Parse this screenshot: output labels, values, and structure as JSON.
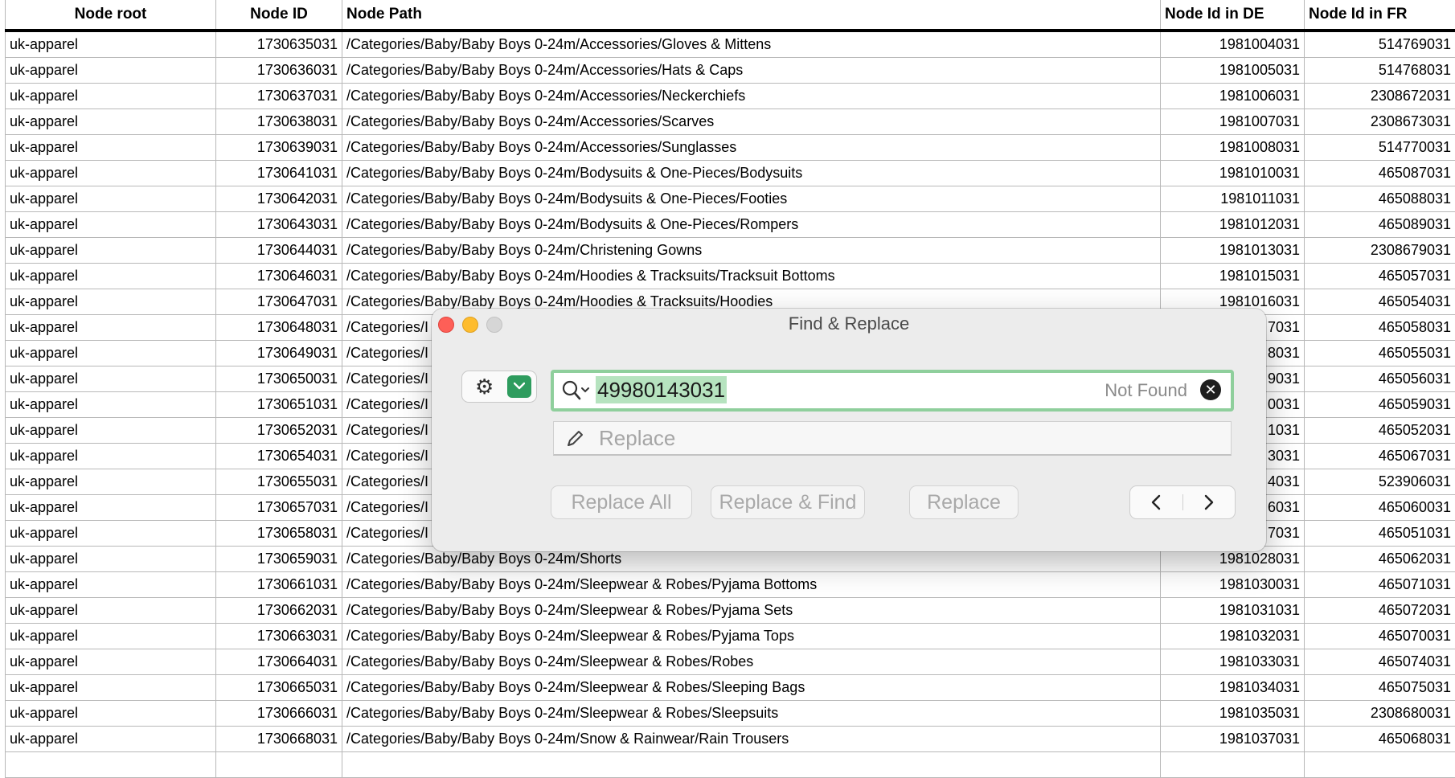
{
  "sheet": {
    "columns": [
      "Node root",
      "Node ID",
      "Node Path",
      "Node Id in DE",
      "Node Id in FR"
    ],
    "rows": [
      [
        "uk-apparel",
        "1730635031",
        "/Categories/Baby/Baby Boys 0-24m/Accessories/Gloves & Mittens",
        "1981004031",
        "514769031"
      ],
      [
        "uk-apparel",
        "1730636031",
        "/Categories/Baby/Baby Boys 0-24m/Accessories/Hats & Caps",
        "1981005031",
        "514768031"
      ],
      [
        "uk-apparel",
        "1730637031",
        "/Categories/Baby/Baby Boys 0-24m/Accessories/Neckerchiefs",
        "1981006031",
        "2308672031"
      ],
      [
        "uk-apparel",
        "1730638031",
        "/Categories/Baby/Baby Boys 0-24m/Accessories/Scarves",
        "1981007031",
        "2308673031"
      ],
      [
        "uk-apparel",
        "1730639031",
        "/Categories/Baby/Baby Boys 0-24m/Accessories/Sunglasses",
        "1981008031",
        "514770031"
      ],
      [
        "uk-apparel",
        "1730641031",
        "/Categories/Baby/Baby Boys 0-24m/Bodysuits & One-Pieces/Bodysuits",
        "1981010031",
        "465087031"
      ],
      [
        "uk-apparel",
        "1730642031",
        "/Categories/Baby/Baby Boys 0-24m/Bodysuits & One-Pieces/Footies",
        "1981011031",
        "465088031"
      ],
      [
        "uk-apparel",
        "1730643031",
        "/Categories/Baby/Baby Boys 0-24m/Bodysuits & One-Pieces/Rompers",
        "1981012031",
        "465089031"
      ],
      [
        "uk-apparel",
        "1730644031",
        "/Categories/Baby/Baby Boys 0-24m/Christening Gowns",
        "1981013031",
        "2308679031"
      ],
      [
        "uk-apparel",
        "1730646031",
        "/Categories/Baby/Baby Boys 0-24m/Hoodies & Tracksuits/Tracksuit Bottoms",
        "1981015031",
        "465057031"
      ],
      [
        "uk-apparel",
        "1730647031",
        "/Categories/Baby/Baby Boys 0-24m/Hoodies & Tracksuits/Hoodies",
        "1981016031",
        "465054031"
      ],
      [
        "uk-apparel",
        "1730648031",
        "/Categories/I",
        "7031",
        "465058031"
      ],
      [
        "uk-apparel",
        "1730649031",
        "/Categories/I",
        "8031",
        "465055031"
      ],
      [
        "uk-apparel",
        "1730650031",
        "/Categories/I",
        "9031",
        "465056031"
      ],
      [
        "uk-apparel",
        "1730651031",
        "/Categories/I",
        "0031",
        "465059031"
      ],
      [
        "uk-apparel",
        "1730652031",
        "/Categories/I",
        "1031",
        "465052031"
      ],
      [
        "uk-apparel",
        "1730654031",
        "/Categories/I",
        "3031",
        "465067031"
      ],
      [
        "uk-apparel",
        "1730655031",
        "/Categories/I",
        "4031",
        "523906031"
      ],
      [
        "uk-apparel",
        "1730657031",
        "/Categories/I",
        "6031",
        "465060031"
      ],
      [
        "uk-apparel",
        "1730658031",
        "/Categories/I",
        "7031",
        "465051031"
      ],
      [
        "uk-apparel",
        "1730659031",
        "/Categories/Baby/Baby Boys 0-24m/Shorts",
        "1981028031",
        "465062031"
      ],
      [
        "uk-apparel",
        "1730661031",
        "/Categories/Baby/Baby Boys 0-24m/Sleepwear & Robes/Pyjama Bottoms",
        "1981030031",
        "465071031"
      ],
      [
        "uk-apparel",
        "1730662031",
        "/Categories/Baby/Baby Boys 0-24m/Sleepwear & Robes/Pyjama Sets",
        "1981031031",
        "465072031"
      ],
      [
        "uk-apparel",
        "1730663031",
        "/Categories/Baby/Baby Boys 0-24m/Sleepwear & Robes/Pyjama Tops",
        "1981032031",
        "465070031"
      ],
      [
        "uk-apparel",
        "1730664031",
        "/Categories/Baby/Baby Boys 0-24m/Sleepwear & Robes/Robes",
        "1981033031",
        "465074031"
      ],
      [
        "uk-apparel",
        "1730665031",
        "/Categories/Baby/Baby Boys 0-24m/Sleepwear & Robes/Sleeping Bags",
        "1981034031",
        "465075031"
      ],
      [
        "uk-apparel",
        "1730666031",
        "/Categories/Baby/Baby Boys 0-24m/Sleepwear & Robes/Sleepsuits",
        "1981035031",
        "2308680031"
      ],
      [
        "uk-apparel",
        "1730668031",
        "/Categories/Baby/Baby Boys 0-24m/Snow & Rainwear/Rain Trousers",
        "1981037031",
        "465068031"
      ],
      [
        "",
        "",
        "",
        "",
        ""
      ]
    ]
  },
  "dialog": {
    "title": "Find & Replace",
    "find_value": "49980143031",
    "find_status": "Not Found",
    "replace_placeholder": "Replace",
    "buttons": {
      "replace_all": "Replace All",
      "replace_and_find": "Replace & Find",
      "replace": "Replace"
    },
    "icons": {
      "options": "gear-icon",
      "search": "magnifier-icon",
      "clear": "clear-icon",
      "replace_field": "pencil-icon",
      "previous": "chevron-left-icon",
      "next": "chevron-right-icon"
    },
    "colors": {
      "find_focus_ring": "#8fcf9c",
      "selection_highlight": "#b6e3bf",
      "options_accent": "#2e9c5e"
    }
  }
}
